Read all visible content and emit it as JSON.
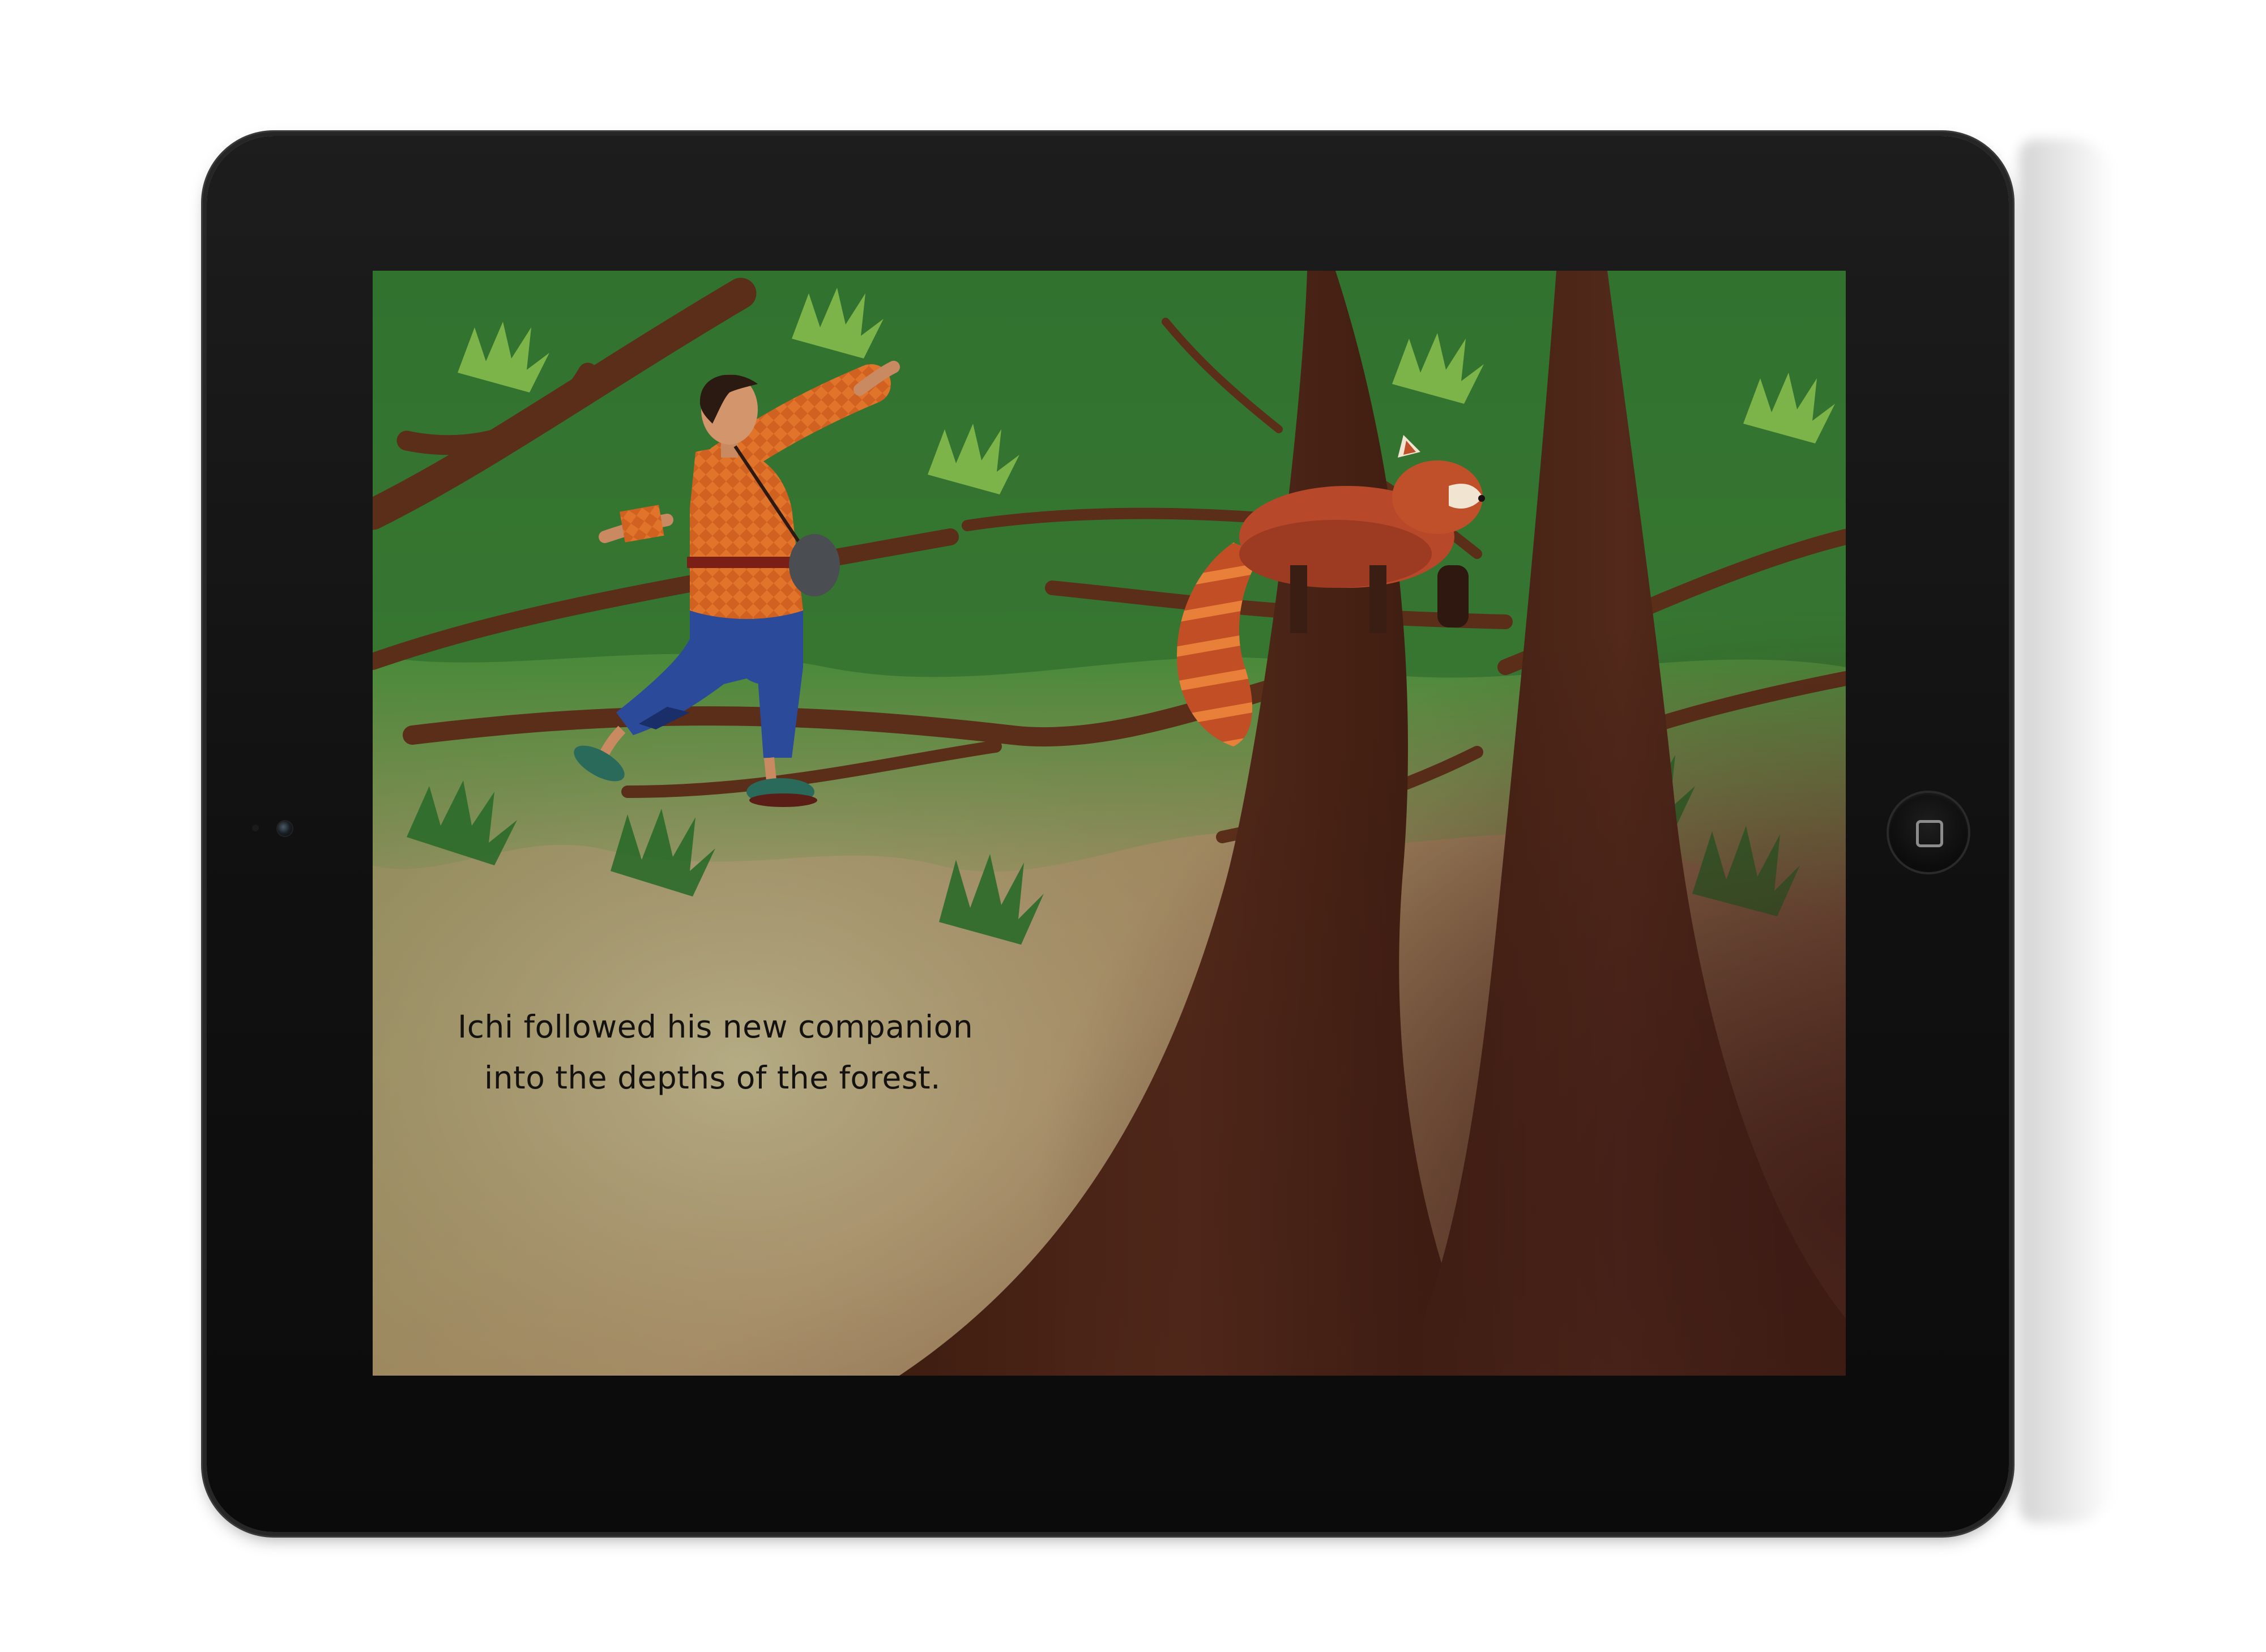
{
  "device": {
    "type": "tablet",
    "orientation": "landscape",
    "bezel_color": "#151515",
    "home_button_icon": "home-button-square-icon",
    "camera_icon": "front-camera-icon"
  },
  "page": {
    "caption_lines": [
      "Ichi followed his new companion",
      "into the depths of the forest."
    ]
  },
  "illustration": {
    "subjects": [
      "boy-icon",
      "red-panda-icon",
      "tree-trunk-icon",
      "leaf-canopy-icon"
    ],
    "colors": {
      "canopy": "#2f7a35",
      "canopy_light": "#7fb24a",
      "bark": "#4a2514",
      "sky_haze": "#a69a72",
      "panda_fur": "#c0502a",
      "shirt": "#e0742a",
      "trousers": "#2c4a9a"
    }
  }
}
